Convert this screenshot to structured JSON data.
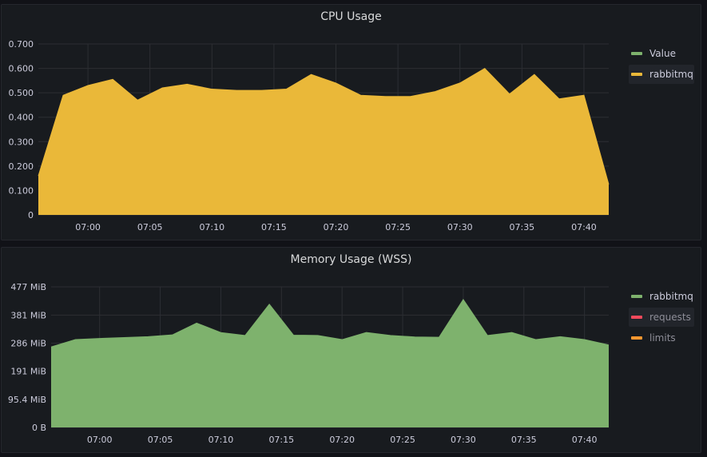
{
  "colors": {
    "green": "#7eb26d",
    "yellow": "#eab839",
    "red": "#f2495c",
    "orange": "#ff9830",
    "grid": "#2c2e33",
    "axis_text": "#ccccdc"
  },
  "panels": [
    {
      "title": "CPU Usage",
      "legend": [
        {
          "label": "Value",
          "color": "#7eb26d"
        },
        {
          "label": "rabbitmq",
          "color": "#eab839"
        }
      ]
    },
    {
      "title": "Memory Usage (WSS)",
      "legend": [
        {
          "label": "rabbitmq",
          "color": "#7eb26d"
        },
        {
          "label": "requests",
          "color": "#f2495c"
        },
        {
          "label": "limits",
          "color": "#ff9830"
        }
      ]
    }
  ],
  "chart_data": [
    {
      "type": "area",
      "title": "CPU Usage",
      "x_unit": "minutes",
      "x_range": [
        "06:56",
        "07:42"
      ],
      "x_ticks": [
        "07:00",
        "07:05",
        "07:10",
        "07:15",
        "07:20",
        "07:25",
        "07:30",
        "07:35",
        "07:40"
      ],
      "x_tick_values": [
        0,
        5,
        10,
        15,
        20,
        25,
        30,
        35,
        40
      ],
      "y_ticks": [
        "0",
        "0.100",
        "0.200",
        "0.300",
        "0.400",
        "0.500",
        "0.600",
        "0.700"
      ],
      "y_tick_values": [
        0,
        0.1,
        0.2,
        0.3,
        0.4,
        0.5,
        0.6,
        0.7
      ],
      "ylim": [
        0,
        0.7
      ],
      "x_domain": [
        -4,
        42
      ],
      "legend_position": "right",
      "series": [
        {
          "name": "rabbitmq",
          "color": "#eab839",
          "x": [
            -4,
            -2,
            0,
            2,
            4,
            6,
            8,
            10,
            12,
            14,
            16,
            18,
            20,
            22,
            24,
            26,
            28,
            30,
            32,
            34,
            36,
            38,
            40,
            42
          ],
          "values": [
            0.16,
            0.49,
            0.53,
            0.555,
            0.47,
            0.52,
            0.535,
            0.515,
            0.51,
            0.51,
            0.515,
            0.575,
            0.54,
            0.49,
            0.485,
            0.485,
            0.505,
            0.54,
            0.6,
            0.495,
            0.575,
            0.475,
            0.49,
            0.125
          ]
        }
      ]
    },
    {
      "type": "area",
      "title": "Memory Usage (WSS)",
      "x_unit": "minutes",
      "x_range": [
        "06:56",
        "07:42"
      ],
      "x_ticks": [
        "07:00",
        "07:05",
        "07:10",
        "07:15",
        "07:20",
        "07:25",
        "07:30",
        "07:35",
        "07:40"
      ],
      "x_tick_values": [
        0,
        5,
        10,
        15,
        20,
        25,
        30,
        35,
        40
      ],
      "y_ticks": [
        "0 B",
        "95.4 MiB",
        "191 MiB",
        "286 MiB",
        "381 MiB",
        "477 MiB"
      ],
      "y_tick_values": [
        0,
        95.4,
        191,
        286,
        381,
        477
      ],
      "ylim": [
        0,
        477
      ],
      "x_domain": [
        -4,
        42
      ],
      "legend_position": "right",
      "series": [
        {
          "name": "rabbitmq",
          "color": "#7eb26d",
          "x": [
            -4,
            -2,
            0,
            2,
            4,
            6,
            8,
            10,
            12,
            14,
            16,
            18,
            20,
            22,
            24,
            26,
            28,
            30,
            32,
            34,
            36,
            38,
            40,
            42
          ],
          "values": [
            273,
            298,
            302,
            305,
            308,
            314,
            354,
            322,
            312,
            418,
            313,
            312,
            298,
            322,
            312,
            307,
            306,
            434,
            312,
            322,
            298,
            308,
            298,
            280
          ]
        }
      ]
    }
  ]
}
